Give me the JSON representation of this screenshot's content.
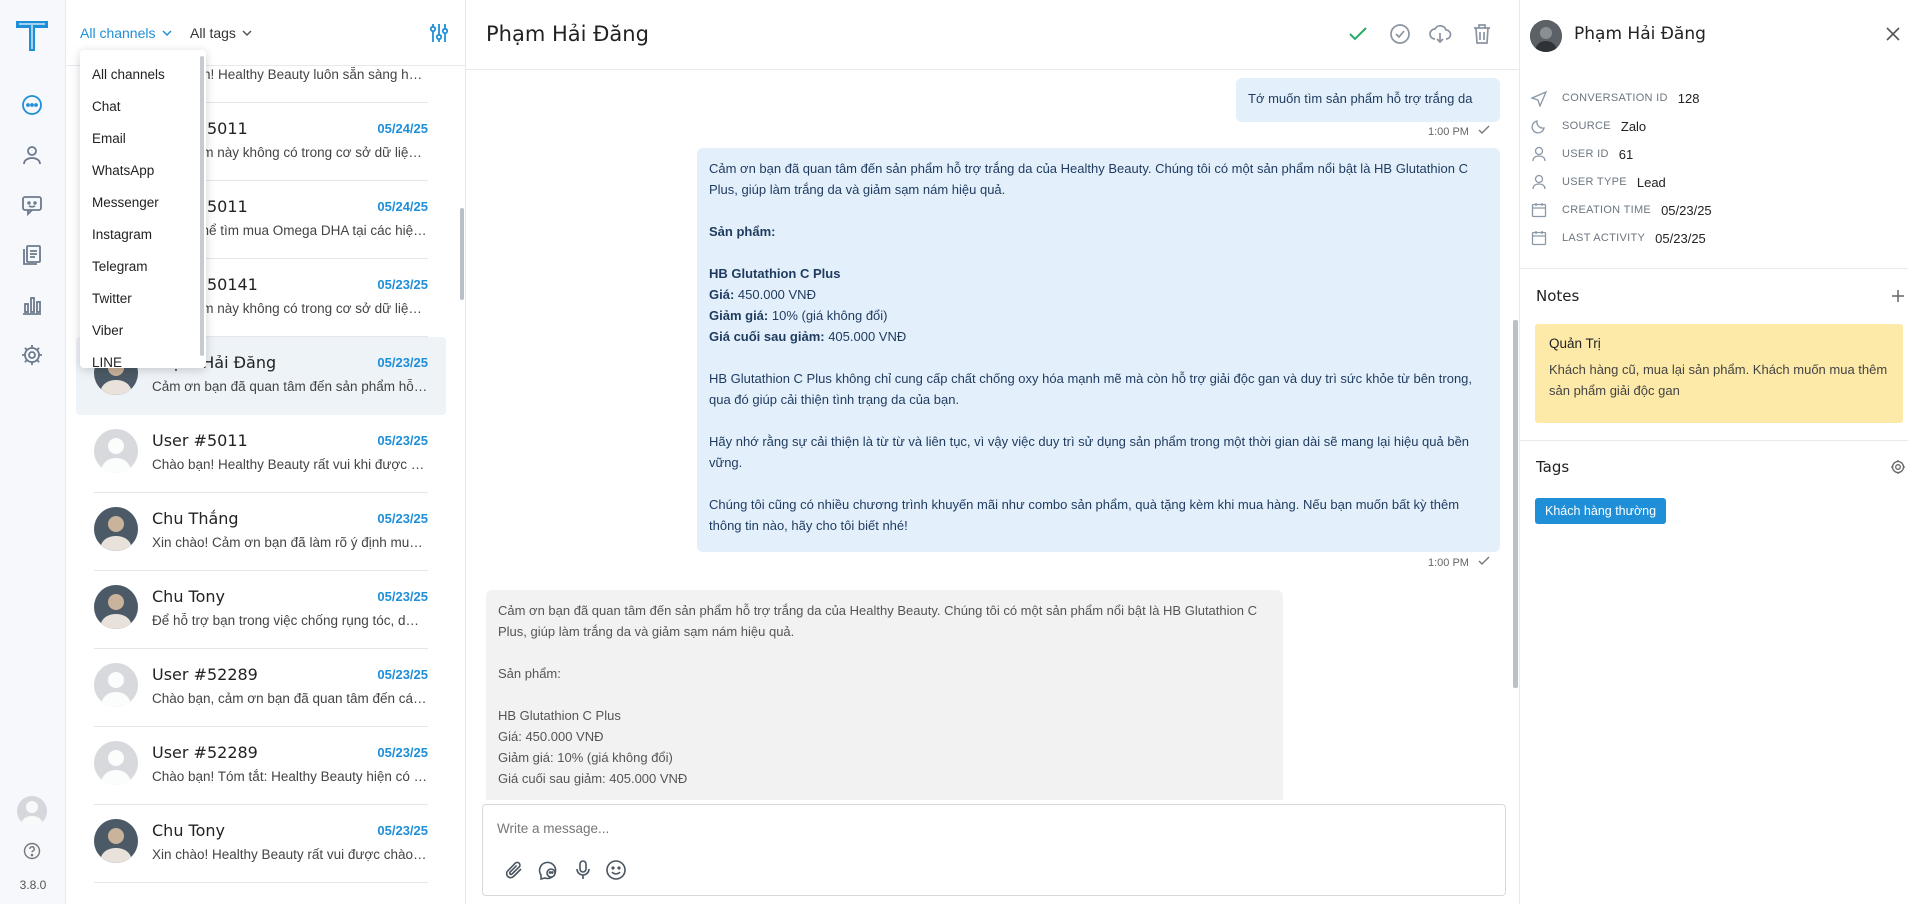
{
  "app": {
    "version": "3.8.0"
  },
  "icons": {
    "logo": "logo-t-icon",
    "nav": [
      "chat-icon",
      "contacts-icon",
      "feedback-icon",
      "documents-icon",
      "analytics-icon",
      "settings-icon"
    ],
    "header": [
      "check-icon",
      "check-circle-icon",
      "cloud-download-icon",
      "trash-icon"
    ],
    "composer": [
      "attach-icon",
      "emoji-chat-icon",
      "microphone-icon",
      "smiley-icon"
    ]
  },
  "colors": {
    "accent": "#1f8fd8",
    "note_bg": "#fdeaa8",
    "outgoing_bubble": "#e3f0fb",
    "incoming_bubble": "#f2f2f2",
    "resolved": "#2aa96b"
  },
  "list": {
    "filter_channels": "All channels",
    "filter_tags": "All tags",
    "dropdown": [
      "All channels",
      "Chat",
      "Email",
      "WhatsApp",
      "Messenger",
      "Instagram",
      "Telegram",
      "Twitter",
      "Viber",
      "LINE"
    ],
    "conversations": [
      {
        "name": "",
        "date": "",
        "preview": "Chào bạn! Healthy Beauty luôn sẵn sàng hỗ trợ bạn",
        "avatar": "default"
      },
      {
        "name": "User #5011",
        "date": "05/24/25",
        "preview": "Sản phẩm này không có trong cơ sở dữ liệu của chúng tôi",
        "avatar": "default"
      },
      {
        "name": "User #5011",
        "date": "05/24/25",
        "preview": "Bạn có thể tìm mua Omega DHA tại các hiệu thuốc",
        "avatar": "default"
      },
      {
        "name": "User #50141",
        "date": "05/23/25",
        "preview": "Sản phẩm này không có trong cơ sở dữ liệu của chúng tôi",
        "avatar": "default"
      },
      {
        "name": "Phạm Hải Đăng",
        "date": "05/23/25",
        "preview": "Cảm ơn bạn đã quan tâm đến sản phẩm hỗ trợ trắng da",
        "avatar": "photo",
        "active": true
      },
      {
        "name": "User #5011",
        "date": "05/23/25",
        "preview": "Chào bạn! Healthy Beauty rất vui khi được giúp đỡ bạn",
        "avatar": "default"
      },
      {
        "name": "Chu Thắng",
        "date": "05/23/25",
        "preview": "Xin chào! Cảm ơn bạn đã làm rõ ý định muốn mua hàng",
        "avatar": "photo"
      },
      {
        "name": "Chu Tony",
        "date": "05/23/25",
        "preview": "Để hỗ trợ bạn trong việc chống rụng tóc, dưỡng tóc",
        "avatar": "photo"
      },
      {
        "name": "User #52289",
        "date": "05/23/25",
        "preview": "Chào bạn, cảm ơn bạn đã quan tâm đến các sản phẩm",
        "avatar": "default"
      },
      {
        "name": "User #52289",
        "date": "05/23/25",
        "preview": "Chào bạn! Tóm tắt: Healthy Beauty hiện có các sản phẩm",
        "avatar": "default"
      },
      {
        "name": "Chu Tony",
        "date": "05/23/25",
        "preview": "Xin chào! Healthy Beauty rất vui được chào đón bạn",
        "avatar": "photo"
      }
    ]
  },
  "chat": {
    "title": "Phạm Hải Đăng",
    "msg1": {
      "text": "Tớ muốn tìm sản phẩm hỗ trợ trắng da",
      "time": "1:00 PM"
    },
    "msg2": {
      "intro": "Cảm ơn bạn đã quan tâm đến sản phẩm hỗ trợ trắng da của Healthy Beauty. Chúng tôi có một sản phẩm nổi bật là HB Glutathion C Plus, giúp làm trắng da và giảm sạm nám hiệu quả.",
      "products_label": "Sản phẩm:",
      "product_name": "HB Glutathion C Plus",
      "price_label": "Giá:",
      "price_value": " 450.000 VNĐ",
      "discount_label": "Giảm giá:",
      "discount_value": " 10% (giá không đổi)",
      "final_label": "Giá cuối sau giảm:",
      "final_value": " 405.000 VNĐ",
      "para1": "HB Glutathion C Plus không chỉ cung cấp chất chống oxy hóa mạnh mẽ mà còn hỗ trợ giải độc gan và duy trì sức khỏe từ bên trong, qua đó giúp cải thiện tình trạng da của bạn.",
      "para2": "Hãy nhớ rằng sự cải thiện là từ từ và liên tục, vì vậy việc duy trì sử dụng sản phẩm trong một thời gian dài sẽ mang lại hiệu quả bền vững.",
      "para3": "Chúng tôi cũng có nhiều chương trình khuyến mãi như combo sản phẩm, quà tặng kèm khi mua hàng. Nếu bạn muốn bất kỳ thêm thông tin nào, hãy cho tôi biết nhé!",
      "time": "1:00 PM"
    },
    "msg3": {
      "intro": "Cảm ơn bạn đã quan tâm đến sản phẩm hỗ trợ trắng da của Healthy Beauty. Chúng tôi có một sản phẩm nổi bật là HB Glutathion C Plus, giúp làm trắng da và giảm sạm nám hiệu quả.",
      "products_label": "Sản phẩm:",
      "product_name": "HB Glutathion C Plus",
      "price": "Giá: 450.000 VNĐ",
      "discount": "Giảm giá: 10% (giá không đổi)",
      "final": "Giá cuối sau giảm: 405.000 VNĐ"
    },
    "composer_placeholder": "Write a message..."
  },
  "info": {
    "name": "Phạm Hải Đăng",
    "attributes": [
      {
        "key": "CONVERSATION ID",
        "value": "128",
        "icon": "send-icon"
      },
      {
        "key": "SOURCE",
        "value": "Zalo",
        "icon": "moon-icon"
      },
      {
        "key": "USER ID",
        "value": "61",
        "icon": "user-icon"
      },
      {
        "key": "USER TYPE",
        "value": "Lead",
        "icon": "user-icon"
      },
      {
        "key": "CREATION TIME",
        "value": "05/23/25",
        "icon": "calendar-icon"
      },
      {
        "key": "LAST ACTIVITY",
        "value": "05/23/25",
        "icon": "calendar-icon"
      }
    ],
    "notes_title": "Notes",
    "note": {
      "author": "Quản Trị",
      "body": "Khách hàng cũ, mua lại sản phẩm. Khách muốn mua thêm sản phẩm giải độc gan"
    },
    "tags_title": "Tags",
    "tags": [
      "Khách hàng thường"
    ]
  }
}
